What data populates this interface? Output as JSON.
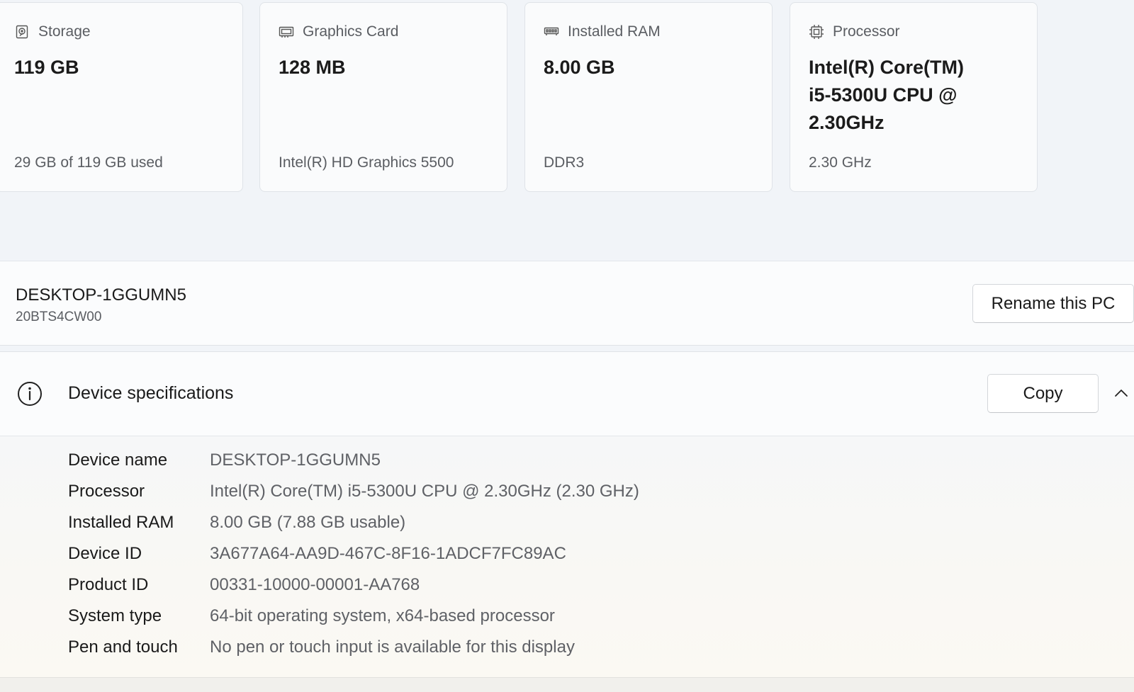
{
  "cards": [
    {
      "title": "Storage",
      "value": "119 GB",
      "sub": "29 GB of 119 GB used",
      "icon": "storage-drive-icon",
      "used_fraction": 0.244
    },
    {
      "title": "Graphics Card",
      "value": "128 MB",
      "sub": "Intel(R) HD Graphics 5500",
      "icon": "graphics-card-icon"
    },
    {
      "title": "Installed RAM",
      "value": "8.00 GB",
      "sub": "DDR3",
      "icon": "ram-icon"
    },
    {
      "title": "Processor",
      "value": "Intel(R) Core(TM) i5-5300U CPU @ 2.30GHz",
      "sub": "2.30 GHz",
      "icon": "processor-chip-icon"
    }
  ],
  "pc": {
    "name": "DESKTOP-1GGUMN5",
    "model": "20BTS4CW00",
    "rename_label": "Rename this PC"
  },
  "specs": {
    "title": "Device specifications",
    "copy_label": "Copy",
    "rows": [
      {
        "label": "Device name",
        "value": "DESKTOP-1GGUMN5"
      },
      {
        "label": "Processor",
        "value": "Intel(R) Core(TM) i5-5300U CPU @ 2.30GHz (2.30 GHz)"
      },
      {
        "label": "Installed RAM",
        "value": "8.00 GB (7.88 GB usable)"
      },
      {
        "label": "Device ID",
        "value": "3A677A64-AA9D-467C-8F16-1ADCF7FC89AC"
      },
      {
        "label": "Product ID",
        "value": "00331-10000-00001-AA768"
      },
      {
        "label": "System type",
        "value": "64-bit operating system, x64-based processor"
      },
      {
        "label": "Pen and touch",
        "value": "No pen or touch input is available for this display"
      }
    ]
  },
  "colors": {
    "page_background": "#f1f4f8",
    "card_background": "#fafbfc",
    "secondary_text": "#5a5d62"
  }
}
